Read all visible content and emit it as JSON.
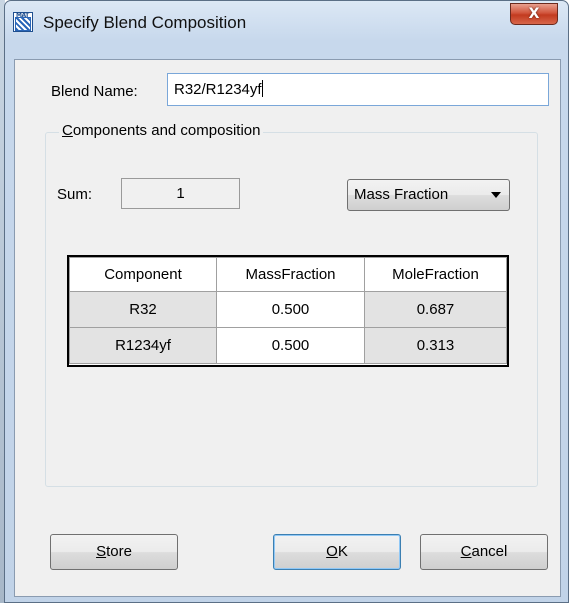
{
  "window": {
    "title": "Specify Blend Composition",
    "close_glyph": "X",
    "app_icon_tag": "MAT"
  },
  "blend": {
    "name_label": "Blend Name:",
    "name_value": "R32/R1234yf"
  },
  "group": {
    "title_accel": "C",
    "title_rest": "omponents and composition"
  },
  "sum": {
    "label": "Sum:",
    "value": "1"
  },
  "mode_select": {
    "selected": "Mass Fraction"
  },
  "table": {
    "columns": [
      "Component",
      "MassFraction",
      "MoleFraction"
    ],
    "rows": [
      {
        "component": "R32",
        "mass_fraction": "0.500",
        "mole_fraction": "0.687"
      },
      {
        "component": "R1234yf",
        "mass_fraction": "0.500",
        "mole_fraction": "0.313"
      }
    ]
  },
  "buttons": {
    "store": {
      "accel": "S",
      "rest": "tore"
    },
    "ok": {
      "accel": "O",
      "rest": "K"
    },
    "cancel": {
      "accel": "C",
      "rest": "ancel"
    }
  },
  "colors": {
    "titlebar": "#c7d8ec",
    "close_button": "#c23a1f",
    "client_bg": "#f0f0f0",
    "input_border": "#7aa7d9"
  }
}
